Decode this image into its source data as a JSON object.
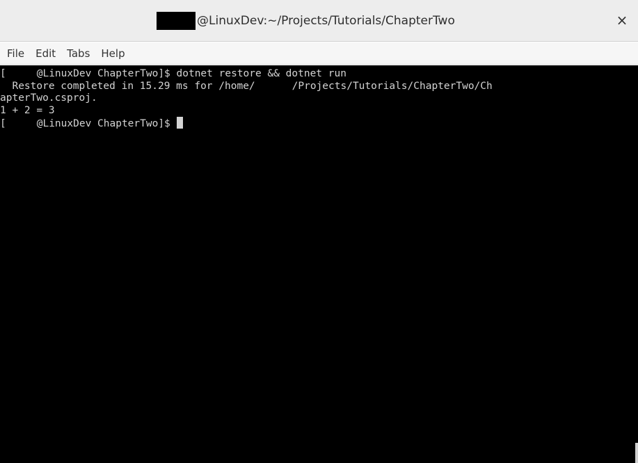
{
  "window": {
    "title": "@LinuxDev:~/Projects/Tutorials/ChapterTwo",
    "close_glyph": "×"
  },
  "menu": [
    "File",
    "Edit",
    "Tabs",
    "Help"
  ],
  "terminal": {
    "line1_prefix": "[",
    "line1_host": "@LinuxDev ChapterTwo]$ dotnet restore && dotnet run",
    "line2_a": "  Restore completed in 15.29 ms for /home/",
    "line2_b": "/Projects/Tutorials/ChapterTwo/Ch",
    "line3": "apterTwo.csproj.",
    "line4": "1 + 2 = 3",
    "line5_prefix": "[",
    "line5_host": "@LinuxDev ChapterTwo]$ "
  },
  "colors": {
    "terminal_bg": "#000000",
    "terminal_fg": "#d3d3d3",
    "titlebar_bg": "#ededed"
  }
}
